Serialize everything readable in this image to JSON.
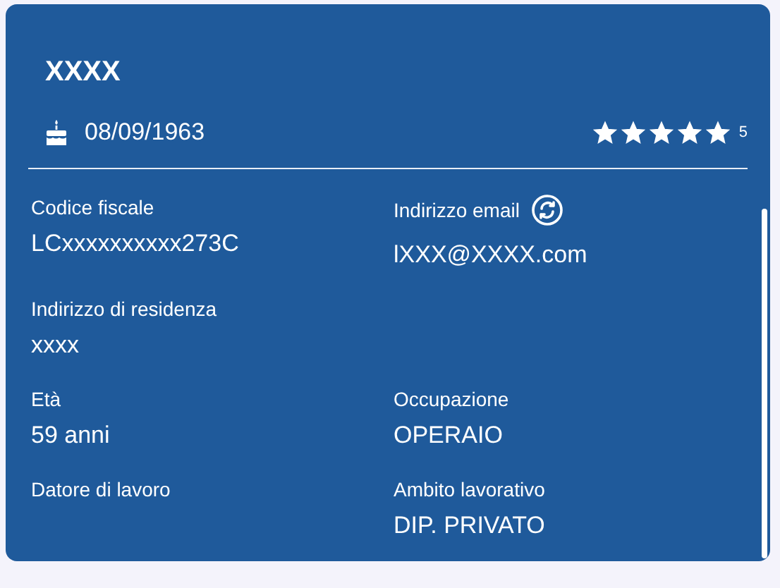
{
  "card": {
    "name": "XXXX",
    "birth_date": "08/09/1963",
    "stars": 5,
    "rating": "5"
  },
  "fields": [
    {
      "kind": "plain",
      "label": "Codice fiscale",
      "value": "LCxxxxxxxxxx273C"
    },
    {
      "kind": "with_icon",
      "label": "Indirizzo email",
      "value": "lXXX@XXXX.com"
    },
    {
      "kind": "plain",
      "label": "Indirizzo di residenza",
      "value": "xxxx"
    },
    {
      "kind": "empty"
    },
    {
      "kind": "plain",
      "label": "Età",
      "value": "59 anni"
    },
    {
      "kind": "plain",
      "label": "Occupazione",
      "value": "OPERAIO"
    },
    {
      "kind": "plain",
      "label": "Datore di lavoro"
    },
    {
      "kind": "plain",
      "label": "Ambito lavorativo",
      "value": "DIP. PRIVATO"
    }
  ]
}
